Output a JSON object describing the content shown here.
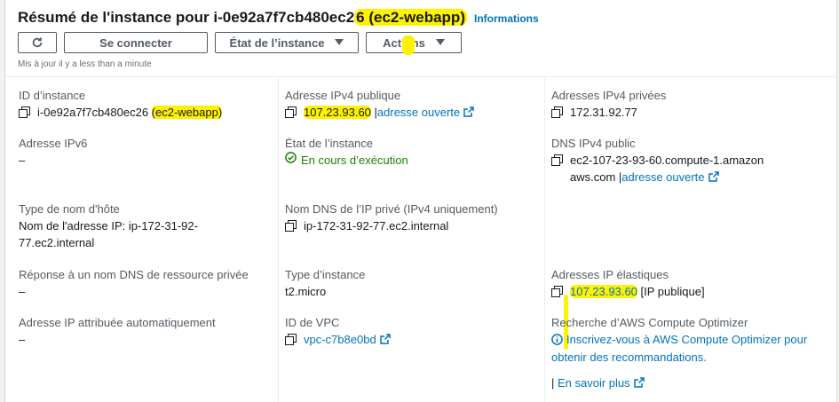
{
  "header": {
    "title_prefix": "Résumé de l'instance pour i-0e92a7f7cb480ec2",
    "title_highlight": "6 (ec2-webapp)",
    "info_link": "Informations",
    "buttons": {
      "connect": "Se connecter",
      "state": "État de l’instance",
      "actions": "Actions"
    },
    "updated": "Mis à jour il y a less than a minute"
  },
  "fields": {
    "instance_id": {
      "label": "ID d’instance",
      "value_plain": "i-0e92a7f7cb480ec26 ",
      "value_highlight": "(ec2-webapp)"
    },
    "ipv6": {
      "label": "Adresse IPv6",
      "value": "–"
    },
    "hostname_type": {
      "label": "Type de nom d'hôte",
      "value": "Nom de l'adresse IP: ip-172-31-92-77.ec2.internal"
    },
    "dns_answer": {
      "label": "Réponse à un nom DNS de ressource privée",
      "value": "–"
    },
    "auto_ip": {
      "label": "Adresse IP attribuée automatiquement",
      "value": "–"
    },
    "public_ipv4": {
      "label": "Adresse IPv4 publique",
      "ip": "107.23.93.60",
      "sep": " |",
      "open": "adresse ouverte"
    },
    "instance_state": {
      "label": "État de l’instance",
      "value": "En cours d’exécution"
    },
    "private_dns": {
      "label": "Nom DNS de l’IP privé (IPv4 uniquement)",
      "value": "ip-172-31-92-77.ec2.internal"
    },
    "instance_type": {
      "label": "Type d’instance",
      "value": "t2.micro"
    },
    "vpc_id": {
      "label": "ID de VPC",
      "value": "vpc-c7b8e0bd"
    },
    "private_ipv4": {
      "label": "Adresses IPv4 privées",
      "value": "172.31.92.77"
    },
    "public_dns": {
      "label": "DNS IPv4 public",
      "value": "ec2-107-23-93-60.compute-1.amazonaws.com",
      "sep": " |",
      "open": "adresse ouverte"
    },
    "elastic_ip": {
      "label": "Adresses IP élastiques",
      "ip": "107.23.93.60",
      "suffix": " [IP publique]"
    },
    "optimizer": {
      "label": "Recherche d’AWS Compute Optimizer",
      "link": "Inscrivez-vous à AWS Compute Optimizer pour obtenir des recommandations.",
      "learn_sep": "| ",
      "learn": "En savoir plus"
    }
  },
  "colors": {
    "link": "#0073bb",
    "running": "#1d8102",
    "highlight": "#fff200"
  },
  "icons": [
    "refresh-icon",
    "caret-down-icon",
    "copy-icon",
    "external-link-icon",
    "check-circle-icon",
    "info-circle-icon"
  ]
}
